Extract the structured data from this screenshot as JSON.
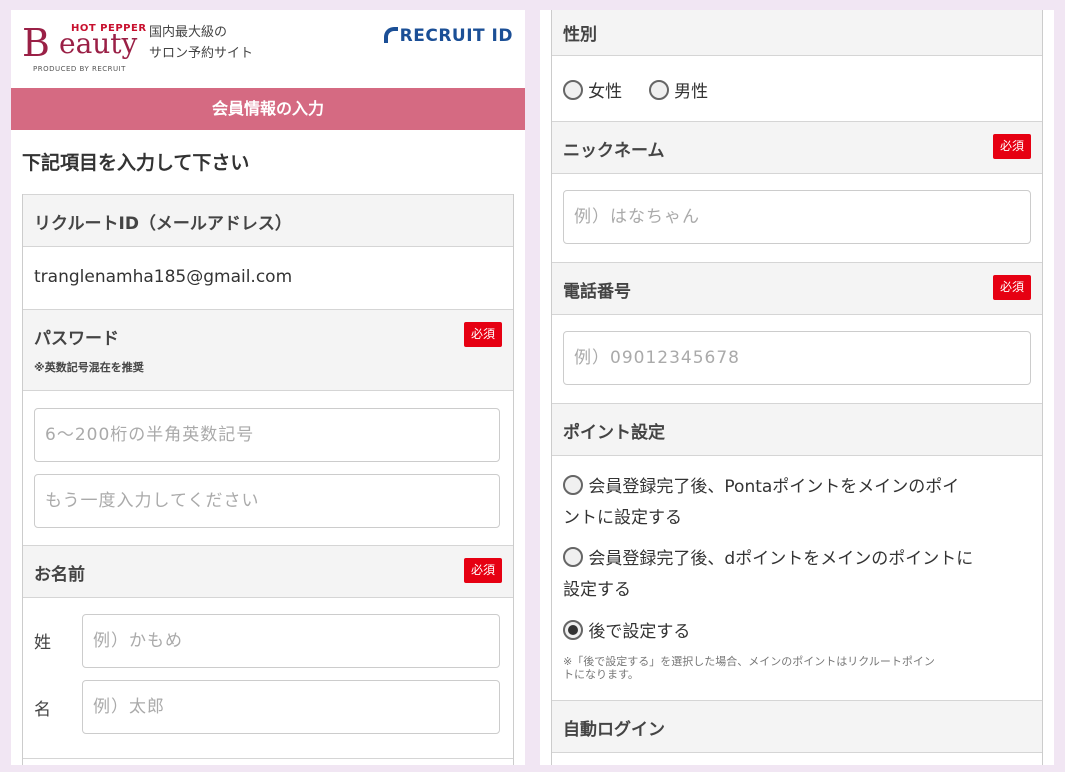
{
  "header": {
    "logo_hotpepper": "HOT PEPPER",
    "logo_initial": "B",
    "logo_rest": "eauty",
    "logo_produced": "PRODUCED BY RECRUIT",
    "tagline_line1": "国内最大級の",
    "tagline_line2": "サロン予約サイト",
    "recruit_id": "RECRUIT ID"
  },
  "page_title_bar": "会員情報の入力",
  "instruction": "下記項目を入力して下さい",
  "required_badge": "必須",
  "fields": {
    "recruit_id": {
      "label": "リクルートID（メールアドレス）",
      "value": "tranglenamha185@gmail.com"
    },
    "password": {
      "label": "パスワード",
      "note": "※英数記号混在を推奨",
      "placeholder": "6〜200桁の半角英数記号",
      "confirm_placeholder": "もう一度入力してください"
    },
    "name": {
      "label": "お名前",
      "last_label": "姓",
      "last_placeholder": "例）かもめ",
      "first_label": "名",
      "first_placeholder": "例）太郎"
    },
    "gender": {
      "label": "性別",
      "options": [
        "女性",
        "男性"
      ]
    },
    "nickname": {
      "label": "ニックネーム",
      "placeholder": "例）はなちゃん"
    },
    "phone": {
      "label": "電話番号",
      "placeholder": "例）09012345678"
    },
    "points": {
      "label": "ポイント設定",
      "option1_line1": "会員登録完了後、Pontaポイントをメインのポイ",
      "option1_line2": "ントに設定する",
      "option2_line1": "会員登録完了後、dポイントをメインのポイントに",
      "option2_line2": "設定する",
      "option3": "後で設定する",
      "selected": "後で設定する",
      "note_line1": "※「後で設定する」を選択した場合、メインのポイントはリクルートポイン",
      "note_line2": "トになります。"
    },
    "auto_login": {
      "label": "自動ログイン"
    }
  },
  "colors": {
    "brand": "#9a2046",
    "title_bar": "#d56a82",
    "required": "#e60012",
    "recruit_blue": "#1b4f96",
    "background": "#f1e6f3"
  }
}
